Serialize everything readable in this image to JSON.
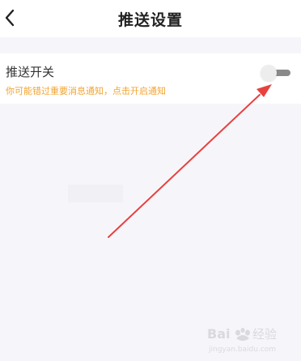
{
  "header": {
    "title": "推送设置",
    "back_icon": "chevron-left-icon"
  },
  "push_setting": {
    "title": "推送开关",
    "hint": "你可能错过重要消息通知，点击开启通知",
    "toggle_state": "off",
    "hint_color": "#f2a432"
  },
  "annotation": {
    "arrow_color": "#e8413e"
  },
  "watermark": {
    "brand": "Baidu经验",
    "url": "jingyan.baidu.com"
  }
}
